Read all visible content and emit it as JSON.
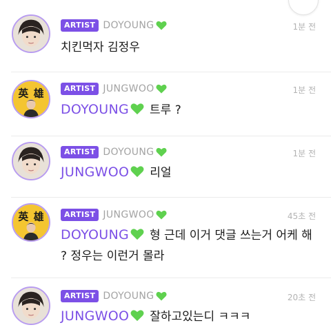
{
  "badge_label": "ARTIST",
  "colors": {
    "accent": "#7c50e6",
    "heart": "#5fd14f",
    "meta_gray": "#a3a3a3",
    "ring": "#b89cf0"
  },
  "comments": [
    {
      "avatar": "doyoung-avatar",
      "author": "DOYOUNG",
      "time": "1분 전",
      "mention": "",
      "text": "치킨먹자 김정우"
    },
    {
      "avatar": "jungwoo-avatar",
      "author": "JUNGWOO",
      "time": "1분 전",
      "mention": "DOYOUNG",
      "text": "트루 ?"
    },
    {
      "avatar": "doyoung-avatar",
      "author": "DOYOUNG",
      "time": "1분 전",
      "mention": "JUNGWOO",
      "text": "리얼"
    },
    {
      "avatar": "jungwoo-avatar",
      "author": "JUNGWOO",
      "time": "45초 전",
      "mention": "DOYOUNG",
      "text": "형 근데 이거 댓글 쓰는거 어케 해 ? 정우는 이런거 몰라"
    },
    {
      "avatar": "doyoung-avatar",
      "author": "DOYOUNG",
      "time": "20초 전",
      "mention": "JUNGWOO",
      "text": "잘하고있는디 ㅋㅋㅋ"
    }
  ]
}
